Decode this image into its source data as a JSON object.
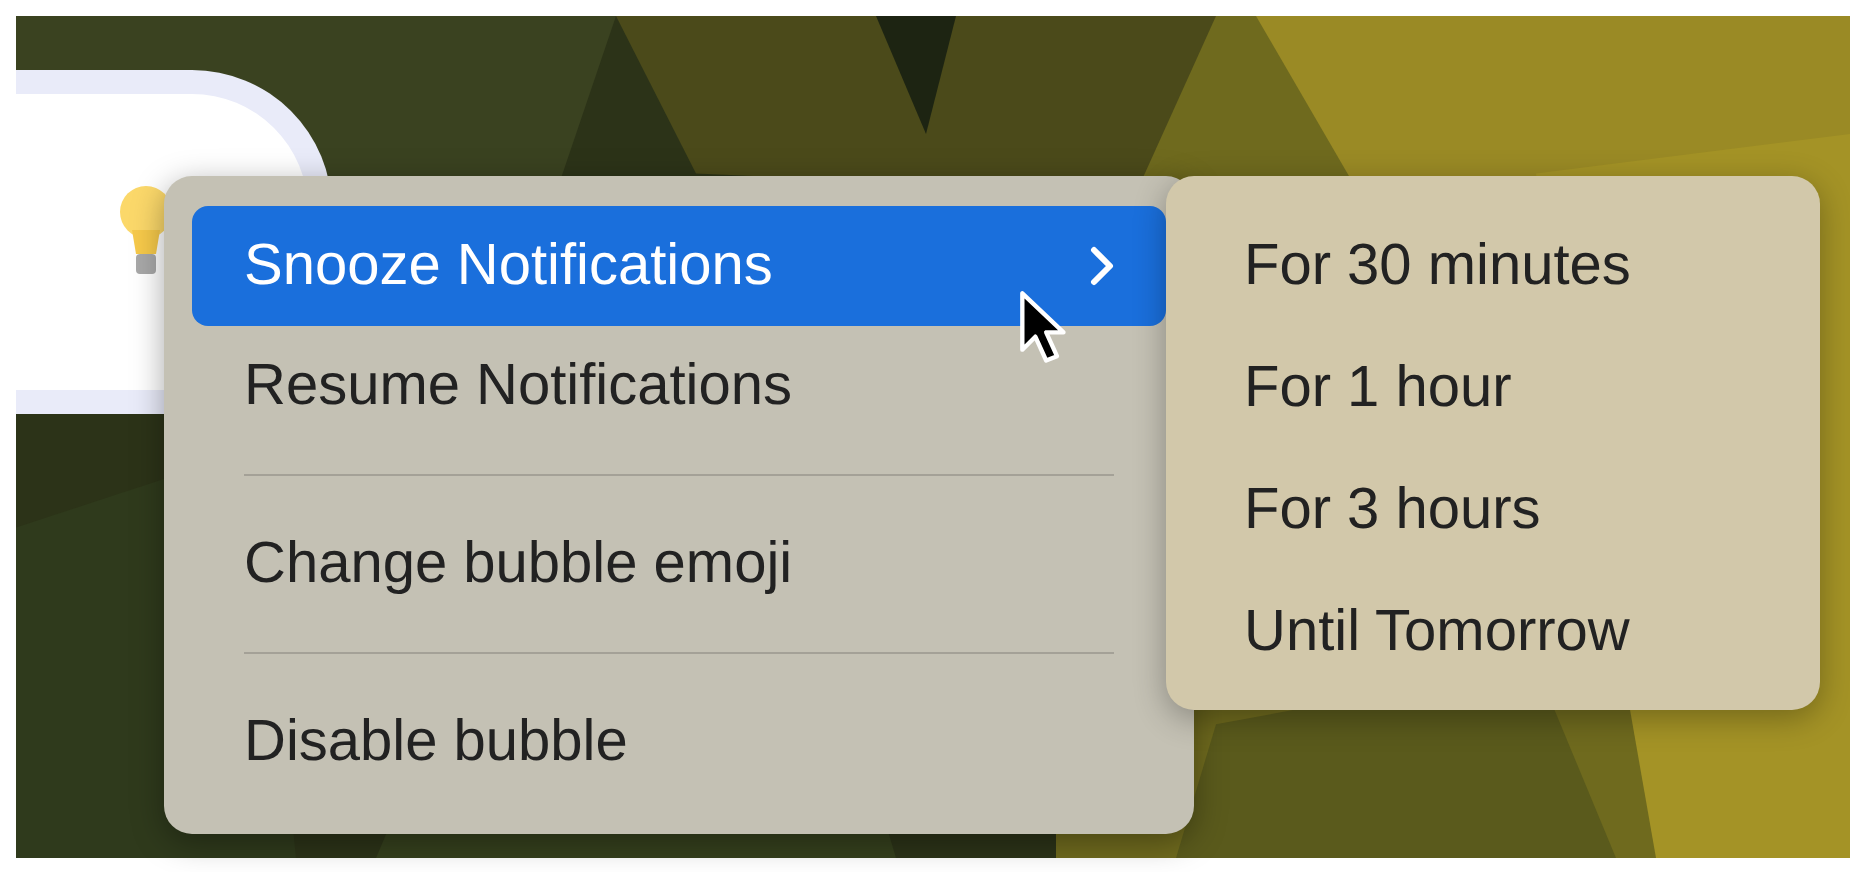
{
  "bubble": {
    "kind": "lightbulb"
  },
  "menu": {
    "items": [
      {
        "kind": "item",
        "label": "Snooze Notifications",
        "selected": true,
        "submenu": true
      },
      {
        "kind": "item",
        "label": "Resume Notifications",
        "selected": false,
        "submenu": false
      },
      {
        "kind": "separator"
      },
      {
        "kind": "item",
        "label": "Change bubble emoji",
        "selected": false,
        "submenu": false
      },
      {
        "kind": "separator"
      },
      {
        "kind": "item",
        "label": "Disable bubble",
        "selected": false,
        "submenu": false
      }
    ]
  },
  "submenu": {
    "items": [
      {
        "label": "For 30 minutes",
        "selected": false
      },
      {
        "label": "For 1 hour",
        "selected": false
      },
      {
        "label": "For 3 hours",
        "selected": false
      },
      {
        "label": "Until Tomorrow",
        "selected": false
      }
    ]
  }
}
